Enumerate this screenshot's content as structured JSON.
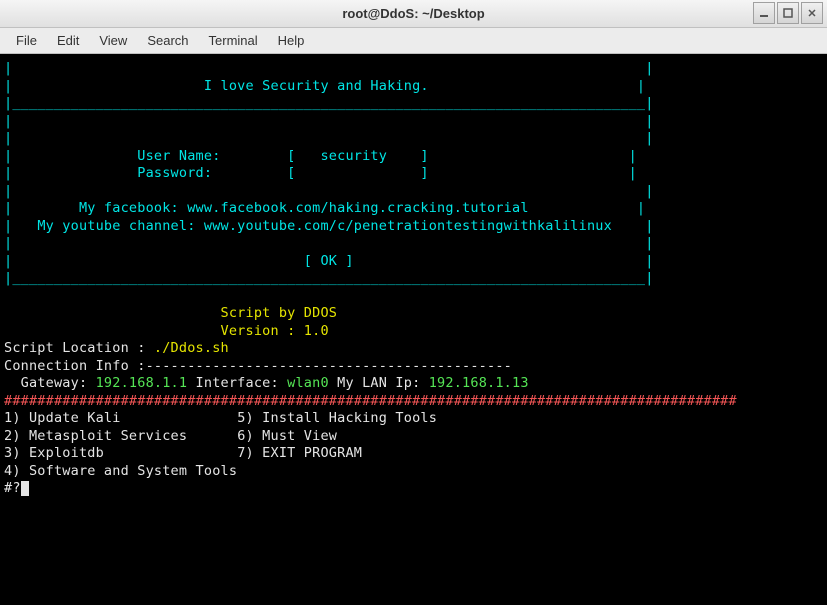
{
  "window": {
    "title": "root@DdoS: ~/Desktop"
  },
  "menubar": {
    "items": [
      "File",
      "Edit",
      "View",
      "Search",
      "Terminal",
      "Help"
    ]
  },
  "banner": {
    "slogan": "I love Security and Haking.",
    "username_label": "User Name:",
    "username_value": "security",
    "password_label": "Password:",
    "facebook_label": "My facebook:",
    "facebook_url": "www.facebook.com/haking.cracking.tutorial",
    "youtube_label": "My youtube channel:",
    "youtube_url": "www.youtube.com/c/penetrationtestingwithkalilinux",
    "ok": "[ OK ]"
  },
  "script_info": {
    "by": "Script by DDOS",
    "version": "Version : 1.0",
    "location_label": "Script Location : ",
    "location_value": "./Ddos.sh"
  },
  "connection": {
    "label": "Connection Info :",
    "dashes": "--------------------------------------------",
    "gateway_label": "Gateway:",
    "gateway_value": "192.168.1.1",
    "interface_label": "Interface:",
    "interface_value": "wlan0",
    "lan_label": "My LAN Ip:",
    "lan_value": "192.168.1.13"
  },
  "hash_line": "########################################################################################",
  "menu": {
    "c1": [
      "1) Update Kali",
      "2) Metasploit Services",
      "3) Exploitdb",
      "4) Software and System Tools"
    ],
    "c2": [
      "5) Install Hacking Tools",
      "6) Must View",
      "7) EXIT PROGRAM",
      ""
    ]
  },
  "prompt": "#?"
}
